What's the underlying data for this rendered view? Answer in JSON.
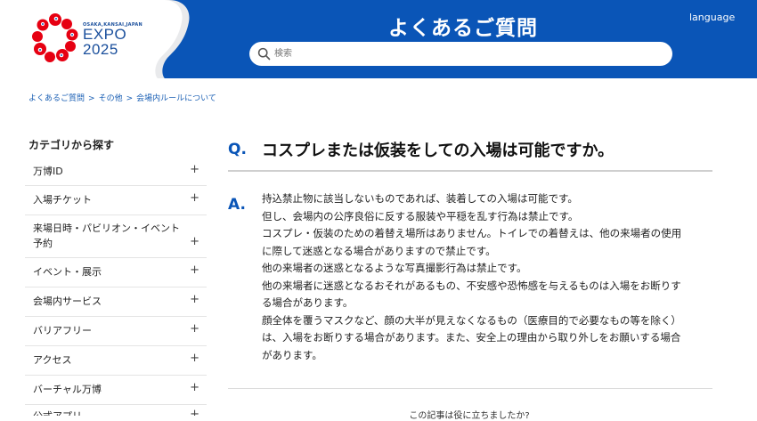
{
  "header": {
    "logo": {
      "small_text": "OSAKA,KANSAI,JAPAN",
      "word": "EXPO",
      "year": "2025"
    },
    "title": "よくあるご質問",
    "language_label": "language",
    "search": {
      "placeholder": "検索",
      "value": ""
    }
  },
  "breadcrumb": [
    "よくあるご質問",
    "その他",
    "会場内ルールについて"
  ],
  "sidebar": {
    "title": "カテゴリから探す",
    "items": [
      {
        "label": "万博ID"
      },
      {
        "label": "入場チケット"
      },
      {
        "label_lines": [
          "来場日時・パビリオン・イベント",
          "予約"
        ]
      },
      {
        "label": "イベント・展示"
      },
      {
        "label": "会場内サービス"
      },
      {
        "label": "バリアフリー"
      },
      {
        "label": "アクセス"
      },
      {
        "label": "バーチャル万博"
      },
      {
        "label": "公式アプリ"
      }
    ],
    "expand_symbol": "+"
  },
  "question": {
    "marker": "Q.",
    "text": "コスプレまたは仮装をしての入場は可能ですか。"
  },
  "answer": {
    "marker": "A.",
    "lines": [
      "持込禁止物に該当しないものであれば、装着しての入場は可能です。",
      "但し、会場内の公序良俗に反する服装や平穏を乱す行為は禁止です。",
      "コスプレ・仮装のための着替え場所はありません。トイレでの着替えは、他の来場者の使用",
      "に際して迷惑となる場合がありますので禁止です。",
      "他の来場者の迷惑となるような写真撮影行為は禁止です。",
      "他の来場者に迷惑となるおそれがあるもの、不安感や恐怖感を与えるものは入場をお断りす",
      "る場合があります。",
      "顔全体を覆うマスクなど、顔の大半が見えなくなるもの（医療目的で必要なもの等を除く）",
      "は、入場をお断りする場合があります。また、安全上の理由から取り外しをお願いする場合",
      "があります。"
    ]
  },
  "feedback": {
    "prompt": "この記事は役に立ちましたか?"
  },
  "colors": {
    "brand_blue": "#0a55b7",
    "logo_red": "#e60012",
    "link_blue": "#1a5fb4"
  }
}
